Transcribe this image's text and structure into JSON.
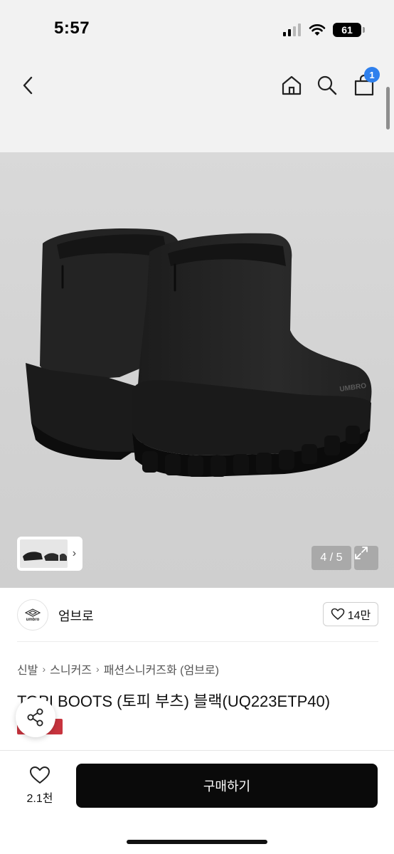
{
  "status_bar": {
    "time": "5:57",
    "battery": "61",
    "icons": [
      "signal-icon",
      "wifi-icon",
      "battery-icon"
    ]
  },
  "header": {
    "icons": [
      "back-icon",
      "home-icon",
      "search-icon",
      "cart-icon"
    ],
    "cart_badge": "1"
  },
  "gallery": {
    "page_indicator": "4 / 5",
    "current_page": 4,
    "total_pages": 5
  },
  "brand": {
    "logo_text": "umbro",
    "name": "엄브로",
    "likes": "14만"
  },
  "breadcrumb": [
    "신발",
    "스니커즈",
    "패션스니커즈화 (엄브로)"
  ],
  "product": {
    "title": "TOPI BOOTS (토피 부츠) 블랙(UQ223ETP40)"
  },
  "bottom_bar": {
    "wish_count": "2.1천",
    "buy_label": "구매하기"
  },
  "colors": {
    "accent_blue": "#2f80ed",
    "buy_button": "#0a0a0a",
    "badge_red": "#c8343e"
  }
}
